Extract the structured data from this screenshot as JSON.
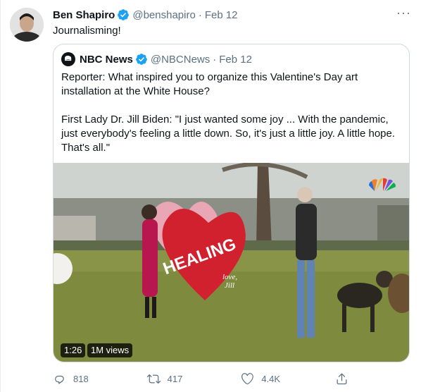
{
  "tweet": {
    "author_name": "Ben Shapiro",
    "handle": "@benshapiro",
    "separator": "·",
    "date": "Feb 12",
    "text": "Journalisming!",
    "more_label": "···"
  },
  "quote": {
    "author_name": "NBC News",
    "handle": "@NBCNews",
    "separator": "·",
    "date": "Feb 12",
    "paragraph1": "Reporter: What inspired you to organize this Valentine's Day art installation at the White House?",
    "paragraph2": "First Lady Dr. Jill Biden: \"I just wanted some joy ... With the pandemic, just everybody's feeling a little down. So, it's just a little joy. A little hope. That's all.\"",
    "video": {
      "duration": "1:26",
      "views": "1M views",
      "heart_text": "HEALING",
      "heart_signature": "love,\nJill"
    }
  },
  "actions": {
    "reply_count": "818",
    "retweet_count": "417",
    "like_count": "4.4K"
  },
  "icons": {
    "verified": "verified-badge-icon",
    "reply": "reply-icon",
    "retweet": "retweet-icon",
    "like": "heart-icon",
    "share": "share-icon"
  },
  "colors": {
    "verified": "#1da1f2",
    "muted": "#5b7083",
    "border": "#cfd9de"
  }
}
